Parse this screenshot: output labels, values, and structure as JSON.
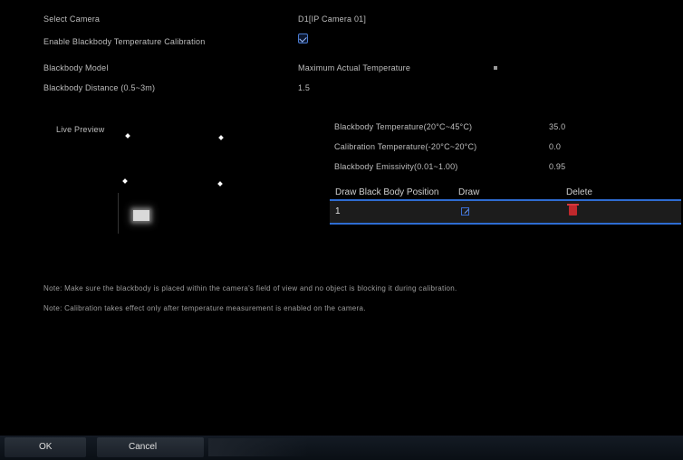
{
  "settings": {
    "row1": {
      "label": "Select Camera",
      "value": "D1[IP Camera 01]"
    },
    "row2": {
      "label": "Enable Blackbody Temperature Calibration"
    },
    "row3": {
      "label": "Blackbody Model",
      "value": "Maximum Actual Temperature"
    },
    "row4": {
      "label": "Blackbody Distance (0.5~3m)",
      "value": "1.5"
    }
  },
  "preview": {
    "label": "Live Preview"
  },
  "params": [
    {
      "label": "Blackbody Temperature(20°C~45°C)",
      "value": "35.0"
    },
    {
      "label": "Calibration Temperature(-20°C~20°C)",
      "value": "0.0"
    },
    {
      "label": "Blackbody Emissivity(0.01~1.00)",
      "value": "0.95"
    }
  ],
  "table": {
    "headers": {
      "position": "Draw Black Body Position",
      "draw": "Draw",
      "delete": "Delete"
    },
    "rows": [
      {
        "index": "1"
      }
    ]
  },
  "notes": [
    "Note: Make sure the blackbody is placed within the camera's field of view and no object is blocking it during calibration.",
    "Note: Calibration takes effect only after temperature measurement is enabled on the camera."
  ],
  "buttons": {
    "ok": "OK",
    "cancel": "Cancel"
  },
  "icons": {
    "checkbox": "checkbox-checked-icon",
    "edit": "edit-icon",
    "delete": "trash-icon"
  },
  "colors": {
    "accent": "#2e6cd1",
    "delete": "#c0282c",
    "background": "#000000"
  }
}
